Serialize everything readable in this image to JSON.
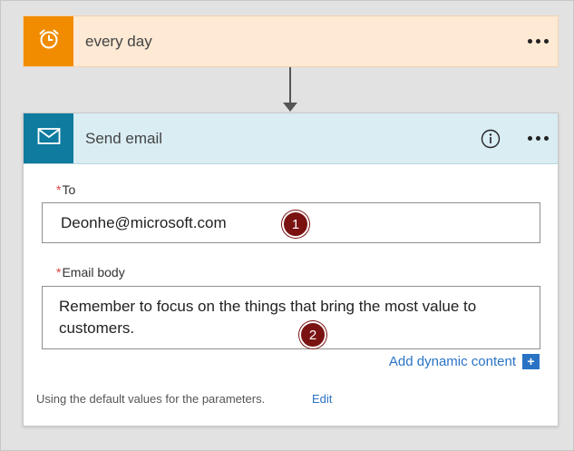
{
  "trigger": {
    "title": "every day",
    "icon": "alarm-clock-icon",
    "accent_color": "#f18c00",
    "background_color": "#fde9d4"
  },
  "action": {
    "title": "Send email",
    "icon": "mail-icon",
    "accent_color": "#0f7b9e",
    "header_color": "#d9edf3",
    "fields": {
      "to": {
        "required_mark": "*",
        "label": "To",
        "value": "Deonhe@microsoft.com",
        "callout": "1"
      },
      "email_body": {
        "required_mark": "*",
        "label": "Email body",
        "value": "Remember to focus on the things that bring the most value to customers.",
        "callout": "2"
      }
    },
    "add_dynamic_content": "Add dynamic content",
    "add_dynamic_plus": "+",
    "footer_note": "Using the default values for the parameters.",
    "edit_label": "Edit"
  },
  "colors": {
    "link": "#2a73c4",
    "callout_badge": "#7a1212",
    "required": "#e04040"
  }
}
